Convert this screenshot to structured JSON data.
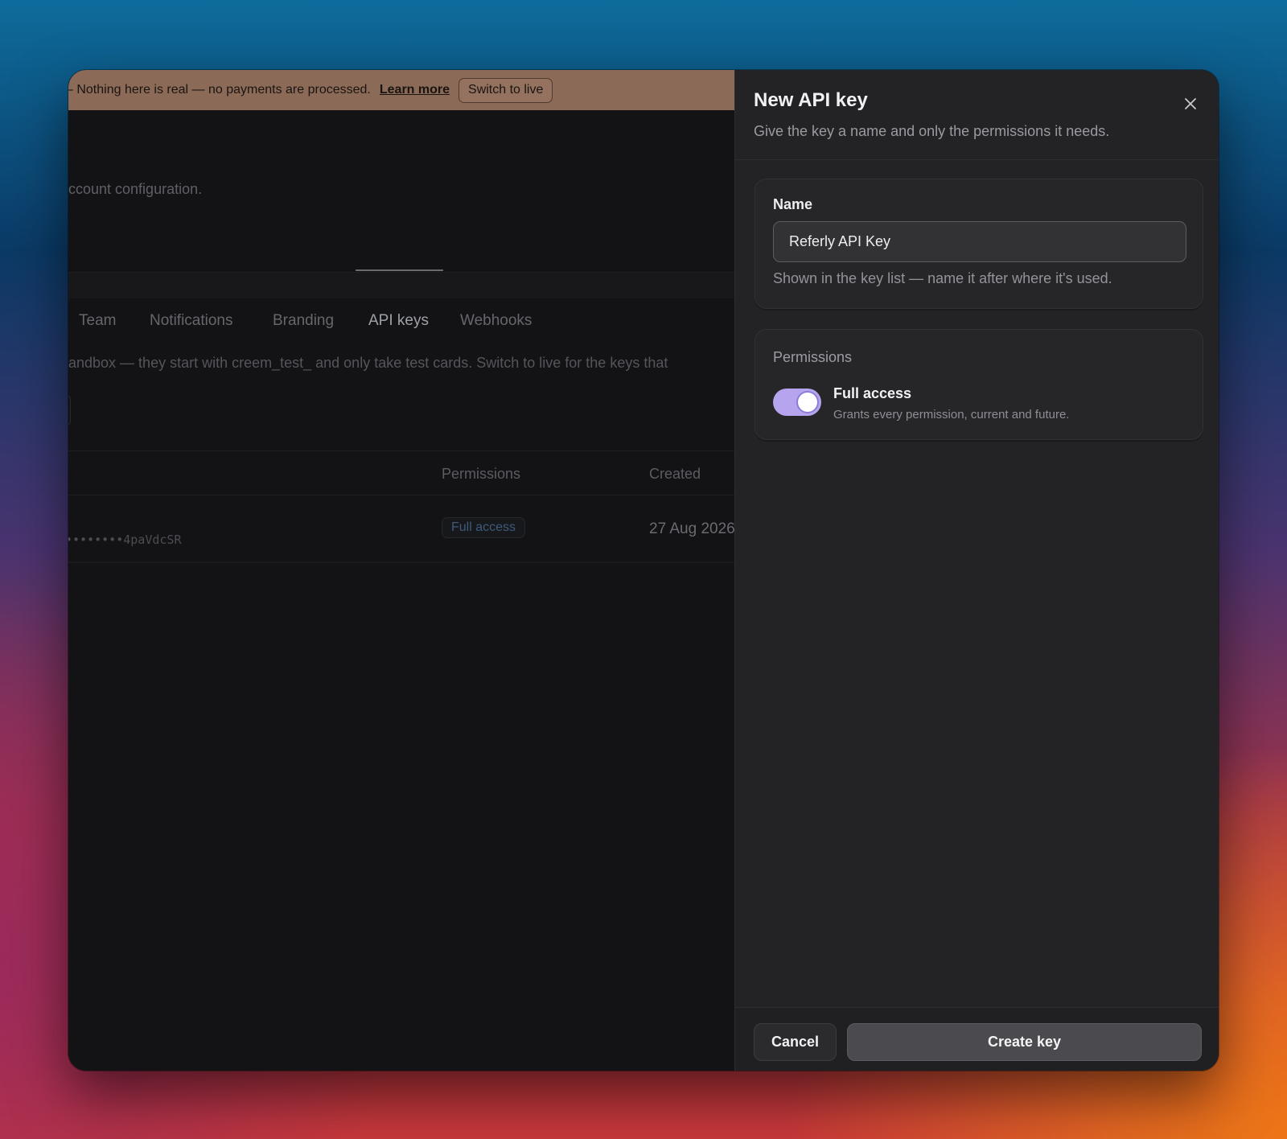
{
  "banner": {
    "message": "– Nothing here is real — no payments are processed.",
    "learn_more": "Learn more",
    "switch_label": "Switch to live"
  },
  "page": {
    "subtitle_fragment": "ccount configuration.",
    "tabs": [
      {
        "label": "Team",
        "active": false
      },
      {
        "label": "Notifications",
        "active": false
      },
      {
        "label": "Branding",
        "active": false
      },
      {
        "label": "API keys",
        "active": true
      },
      {
        "label": "Webhooks",
        "active": false
      }
    ],
    "info_fragment": "andbox — they start with creem_test_ and only take test cards. Switch to live for the keys that",
    "table": {
      "headers": {
        "permissions": "Permissions",
        "created": "Created"
      },
      "rows": [
        {
          "key": "••••••••4paVdcSR",
          "permission": "Full access",
          "created": "27 Aug 2026"
        }
      ]
    }
  },
  "panel": {
    "title": "New API key",
    "description": "Give the key a name and only the permissions it needs.",
    "close_icon": "close-icon",
    "name": {
      "label": "Name",
      "value": "Referly API Key",
      "hint": "Shown in the key list — name it after where it's used."
    },
    "permissions": {
      "label": "Permissions",
      "full_access": {
        "title": "Full access",
        "description": "Grants every permission, current and future.",
        "enabled": true
      }
    },
    "cancel_label": "Cancel",
    "create_label": "Create key"
  },
  "colors": {
    "banner_bg": "#8c6a58",
    "panel_bg": "#232325",
    "toggle_on": "#b6a5ee",
    "badge_text": "#3f5a7a"
  }
}
